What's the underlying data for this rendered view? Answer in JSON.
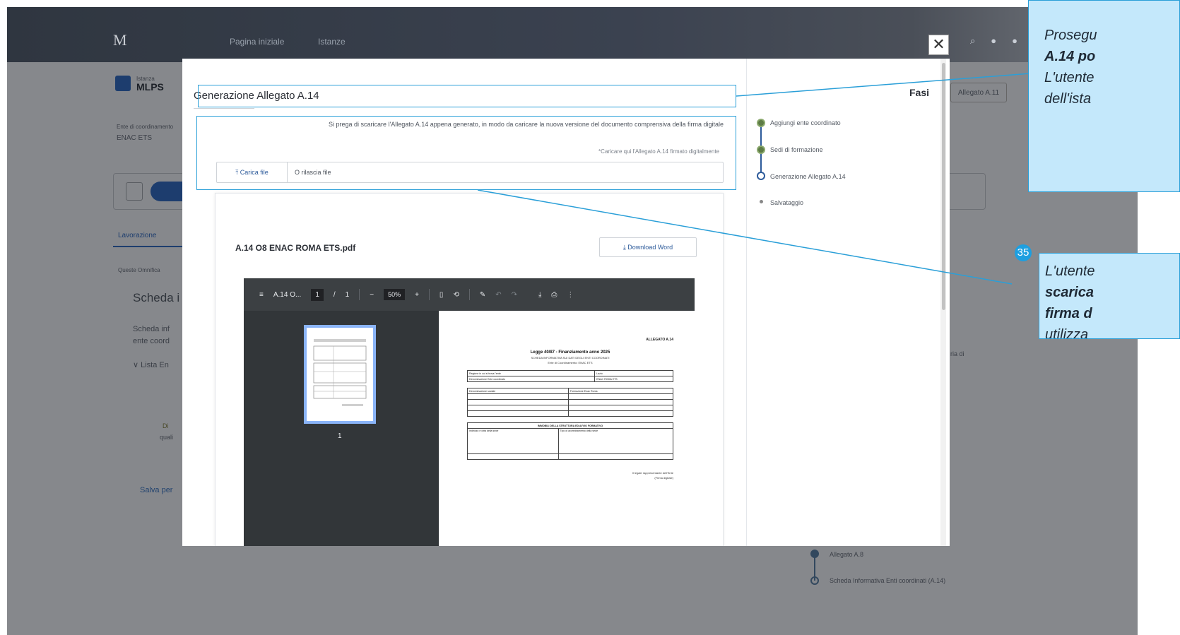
{
  "background_app": {
    "logo_text": "M",
    "nav_items": [
      "Pagina iniziale",
      "Istanze"
    ],
    "header_label": "Istanza",
    "header_title": "MLPS",
    "entity_label": "Ente di coordinamento",
    "entity_value": "ENAC ETS",
    "tab_label": "Lavorazione",
    "section_label": "Queste Omnifica",
    "card_title": "Scheda i",
    "card_text_1": "Scheda inf",
    "card_text_2": "ente coord",
    "list_label": "Lista En",
    "warning_text_1": "Di",
    "warning_text_2": "quali",
    "save_link": "Salva per",
    "right_button": "Allegato A.11",
    "right_step_1": "Allegato A.8",
    "right_step_2": "Scheda Informativa Enti coordinati (A.14)",
    "right_note": "ria di"
  },
  "modal": {
    "title": "Generazione Allegato A.14",
    "close_symbol": "✕",
    "instructions": "Si prega di scaricare l'Allegato A.14 appena generato, in modo da caricare la nuova versione del documento comprensiva della firma digitale",
    "upload_hint": "*Caricare qui l'Allegato A.14 firmato digitalmente",
    "upload_button": "Carica file",
    "upload_icon": "upload-icon",
    "drop_text": "O rilascia file",
    "document_name": "A.14 O8 ENAC ROMA ETS.pdf",
    "download_button": "Download Word",
    "download_icon": "download-icon"
  },
  "pdf_viewer": {
    "filename": "A.14 O...",
    "page_current": "1",
    "page_total": "1",
    "zoom": "50%",
    "thumb_page_number": "1",
    "page": {
      "allegato_label": "ALLEGATO A.14",
      "title": "Legge 40/87 - Finanziamento anno 2025",
      "subtitle_1": "SCHEDA INFORMATIVA SUI DATI DEGLI ENTI COORDINATI",
      "subtitle_2": "Ente di Coordinamento: ENAC ETS",
      "row_1_label": "Regione in cui si trova l'ente",
      "row_1_value": "Lazio",
      "row_2_label": "Denominazione Ente coordinato",
      "row_2_value": "ENAC ROMA ETS",
      "row_3_label": "Denominazione sociale",
      "row_3_value": "Formazione Enac Roma",
      "section_title": "IMMOBILI DELLA STRUTTURA ED AVVIO FORMATIVO",
      "col_1": "Indirizzo e città della sede",
      "col_2": "Tipo di accreditamento della sede",
      "sign_text_1": "Il legale rappresentante dell'Ente",
      "sign_text_2": "(Firma digitale)"
    }
  },
  "steps_panel": {
    "title": "Fasi",
    "steps": [
      {
        "label": "Aggiungi ente coordinato",
        "state": "done"
      },
      {
        "label": "Sedi di formazione",
        "state": "done"
      },
      {
        "label": "Generazione Allegato A.14",
        "state": "current"
      },
      {
        "label": "Salvataggio",
        "state": "todo"
      }
    ]
  },
  "callouts": [
    {
      "lines": [
        "Prosegu",
        "A.14 po",
        "L'utente",
        "dell'ista"
      ]
    },
    {
      "number": "35",
      "lines": [
        "L'utente",
        "scarica",
        "firma d",
        "utilizza"
      ]
    }
  ],
  "colors": {
    "accent": "#2a9fd8",
    "callout_bg": "#c4e8fb",
    "primary": "#2c5a9a",
    "dark_navy": "#1d3d6e"
  }
}
